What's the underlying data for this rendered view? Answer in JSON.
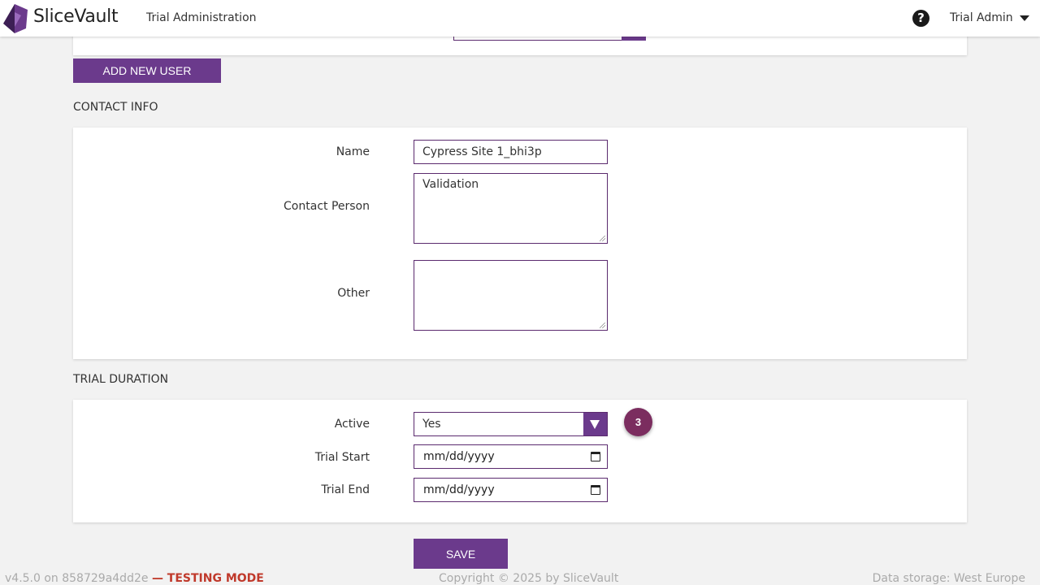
{
  "header": {
    "brand": "SliceVault",
    "title": "Trial Administration",
    "help_icon": "question-circle-icon",
    "help_glyph": "?",
    "user": "Trial Admin"
  },
  "actions": {
    "add_user_label": "ADD NEW USER",
    "save_label": "SAVE"
  },
  "contact_info": {
    "section_title": "CONTACT INFO",
    "name_label": "Name",
    "name_value": "Cypress Site 1_bhi3p",
    "contact_person_label": "Contact Person",
    "contact_person_value": "Validation",
    "other_label": "Other",
    "other_value": ""
  },
  "trial_duration": {
    "section_title": "TRIAL DURATION",
    "active_label": "Active",
    "active_value": "Yes",
    "trial_start_label": "Trial Start",
    "trial_start_placeholder": "mm/dd/yyyy",
    "trial_end_label": "Trial End",
    "trial_end_placeholder": "mm/dd/yyyy",
    "step_badge": "3"
  },
  "footer": {
    "version": "v4.5.0 on 858729a4dd2e",
    "mode": "— TESTING MODE",
    "copyright": "Copyright © 2025 by SliceVault",
    "storage": "Data storage: West Europe"
  },
  "colors": {
    "accent": "#6b3a8c",
    "badge": "#7b2d5f",
    "testing_mode": "#c0392b",
    "background": "#f2f2f2"
  }
}
